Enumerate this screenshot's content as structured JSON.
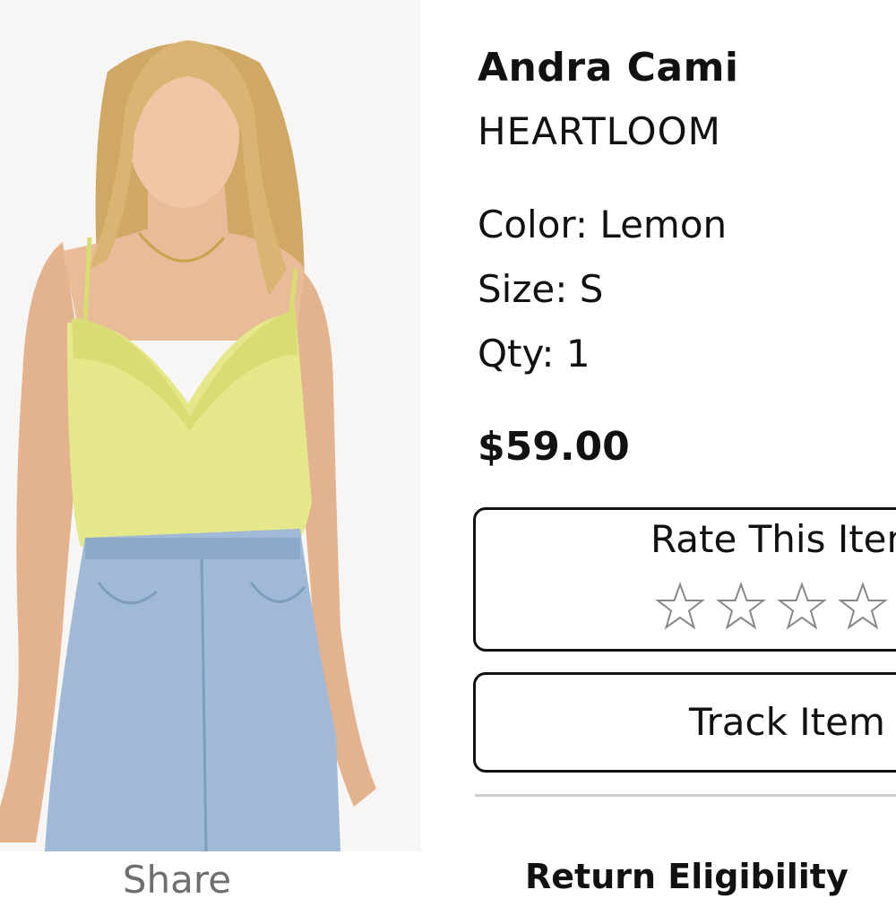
{
  "product": {
    "name": "Andra Cami",
    "brand": "HEARTLOOM",
    "color_line": "Color: Lemon",
    "size_line": "Size: S",
    "qty_line": "Qty: 1",
    "price": "$59.00"
  },
  "photo": {
    "alt": "Model wearing lemon lace-trim cami with light blue jeans"
  },
  "actions": {
    "share_label": "Share",
    "rate_label": "Rate This Item",
    "rating": 0,
    "stars": [
      "star-1",
      "star-2",
      "star-3",
      "star-4"
    ],
    "track_label": "Track Item"
  },
  "footer": {
    "return_label": "Return Eligibility"
  },
  "colors": {
    "cami": "#e4e88a",
    "jeans": "#9fb9d6",
    "border": "#111111",
    "muted": "#6f6f6f"
  }
}
